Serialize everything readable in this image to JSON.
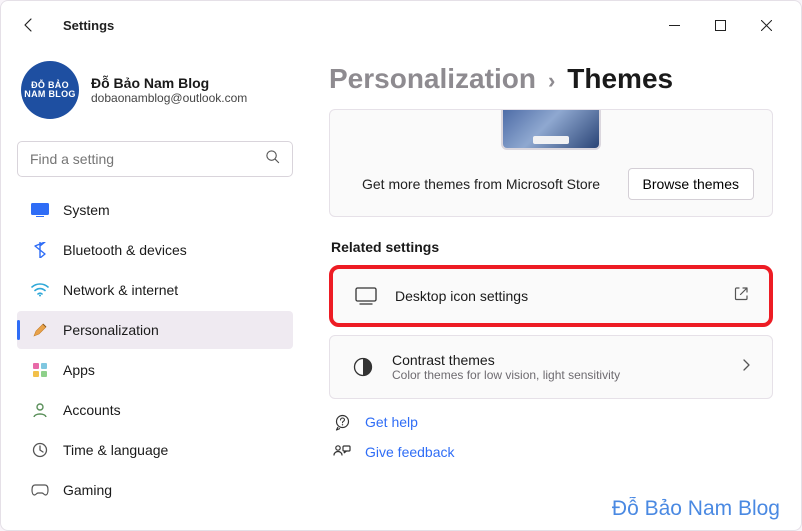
{
  "window": {
    "title": "Settings"
  },
  "profile": {
    "name": "Đỗ Bảo Nam Blog",
    "email": "dobaonamblog@outlook.com",
    "avatar_text1": "ĐỖ BẢO NAM BLOG"
  },
  "search": {
    "placeholder": "Find a setting"
  },
  "nav": {
    "items": [
      {
        "label": "System"
      },
      {
        "label": "Bluetooth & devices"
      },
      {
        "label": "Network & internet"
      },
      {
        "label": "Personalization"
      },
      {
        "label": "Apps"
      },
      {
        "label": "Accounts"
      },
      {
        "label": "Time & language"
      },
      {
        "label": "Gaming"
      }
    ],
    "active_index": 3
  },
  "breadcrumb": {
    "parent": "Personalization",
    "current": "Themes"
  },
  "themes": {
    "store_msg": "Get more themes from Microsoft Store",
    "browse_btn": "Browse themes"
  },
  "related": {
    "header": "Related settings",
    "desktop_icons": {
      "title": "Desktop icon settings"
    },
    "contrast": {
      "title": "Contrast themes",
      "sub": "Color themes for low vision, light sensitivity"
    }
  },
  "help": {
    "get_help": "Get help",
    "feedback": "Give feedback"
  },
  "watermark": "Đỗ Bảo Nam Blog"
}
